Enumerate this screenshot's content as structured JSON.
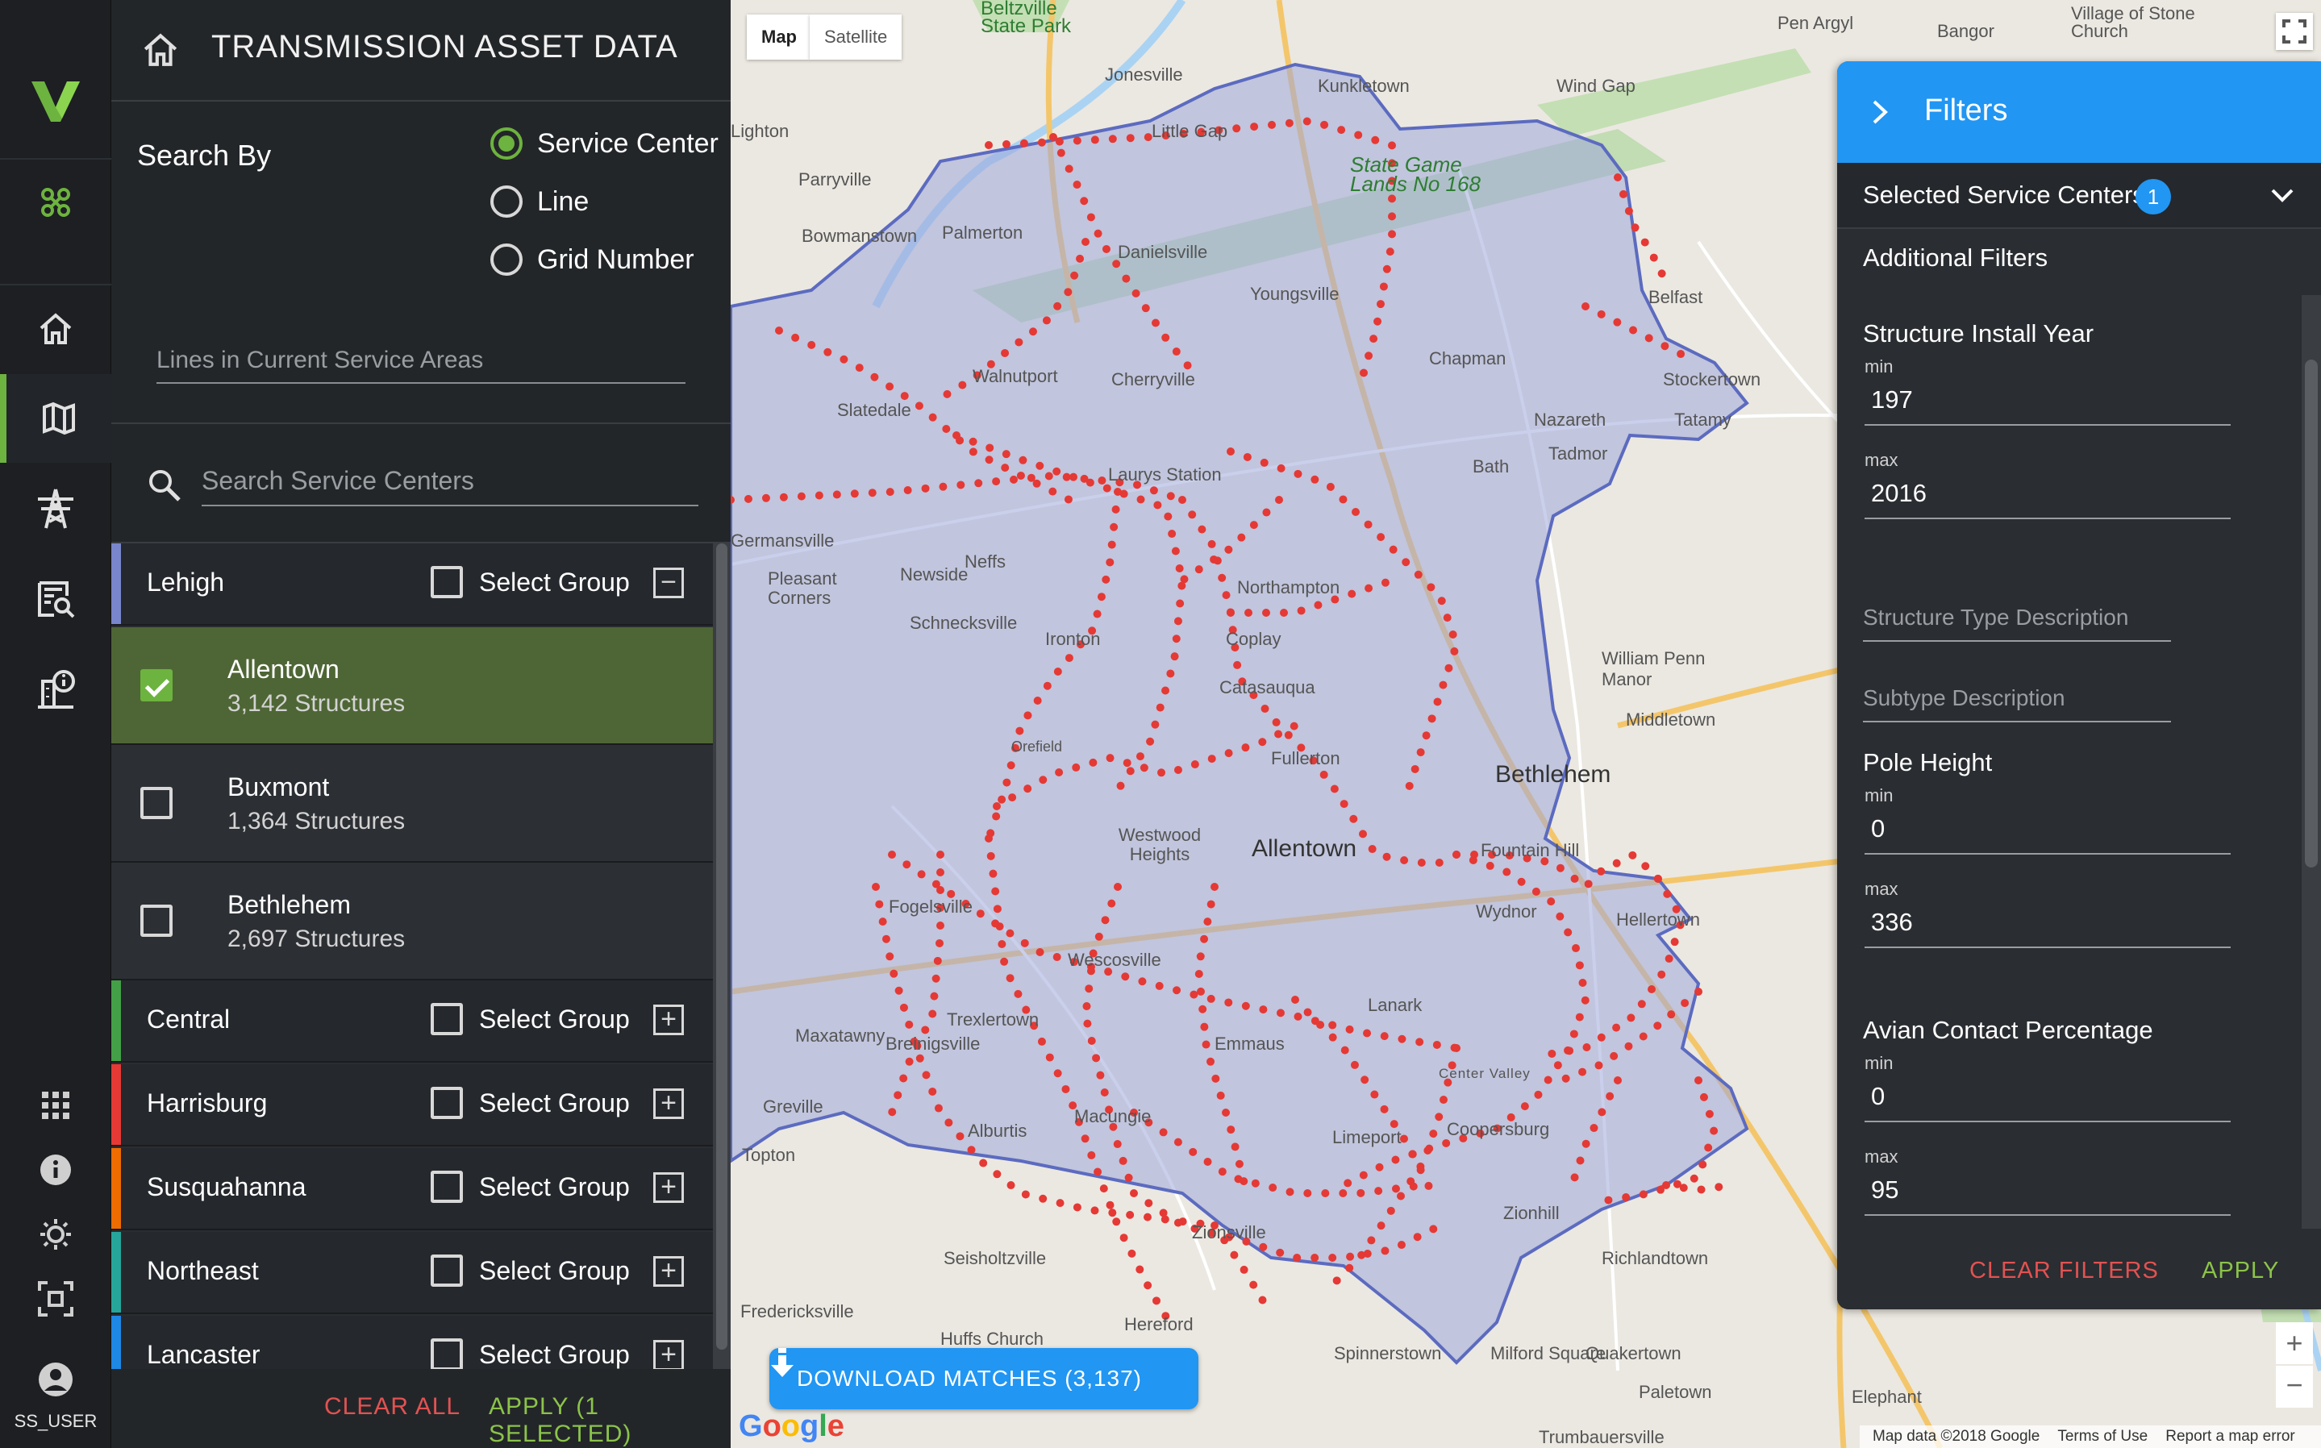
{
  "colors": {
    "accent_green": "#6db33f",
    "accent_blue": "#2196f3",
    "danger_red": "#e25252",
    "map_points": "#e53935",
    "service_area_fill": "#9fa8da"
  },
  "rail": {
    "logo_icon": "brand-v-logo",
    "items": [
      {
        "icon": "network-icon"
      },
      {
        "icon": "home-icon"
      },
      {
        "icon": "map-icon"
      },
      {
        "icon": "transmission-tower-icon"
      },
      {
        "icon": "report-search-icon"
      },
      {
        "icon": "building-info-icon"
      }
    ],
    "bottom_items": [
      {
        "icon": "apps-grid-icon"
      },
      {
        "icon": "info-icon"
      },
      {
        "icon": "settings-gear-icon"
      },
      {
        "icon": "focus-frame-icon"
      },
      {
        "icon": "user-avatar-icon"
      }
    ],
    "user": "SS_USER"
  },
  "panel": {
    "title": "TRANSMISSION ASSET DATA",
    "search_by_label": "Search By",
    "search_by_options": [
      {
        "label": "Service Center",
        "selected": true
      },
      {
        "label": "Line",
        "selected": false
      },
      {
        "label": "Grid Number",
        "selected": false
      }
    ],
    "lines_placeholder": "Lines in Current Service Areas",
    "search_placeholder": "Search Service Centers",
    "select_group_label": "Select Group",
    "groups": [
      {
        "name": "Lehigh",
        "color": "#7986cb",
        "expanded": true,
        "centers": [
          {
            "name": "Allentown",
            "count": "3,142 Structures",
            "checked": true
          },
          {
            "name": "Buxmont",
            "count": "1,364 Structures",
            "checked": false
          },
          {
            "name": "Bethlehem",
            "count": "2,697 Structures",
            "checked": false
          }
        ]
      },
      {
        "name": "Central",
        "color": "#43a047",
        "expanded": false
      },
      {
        "name": "Harrisburg",
        "color": "#e53935",
        "expanded": false
      },
      {
        "name": "Susquahanna",
        "color": "#ef6c00",
        "expanded": false
      },
      {
        "name": "Northeast",
        "color": "#26a69a",
        "expanded": false
      },
      {
        "name": "Lancaster",
        "color": "#1e88e5",
        "expanded": false
      }
    ],
    "clear_all": "CLEAR ALL",
    "apply": "APPLY (1 SELECTED)"
  },
  "map": {
    "type_buttons": [
      "Map",
      "Satellite"
    ],
    "places": [
      {
        "name": "Beltzville State Park"
      },
      {
        "name": "Pen Argyl"
      },
      {
        "name": "Bangor"
      },
      {
        "name": "Village of Stone Church"
      },
      {
        "name": "Jonesville"
      },
      {
        "name": "Kunkletown"
      },
      {
        "name": "Wind Gap"
      },
      {
        "name": "Little Gap"
      },
      {
        "name": "State Game Lands No 168"
      },
      {
        "name": "Lighton"
      },
      {
        "name": "Parryville"
      },
      {
        "name": "Bowmanstown"
      },
      {
        "name": "Palmerton"
      },
      {
        "name": "Danielsville"
      },
      {
        "name": "Youngsville"
      },
      {
        "name": "Belfast"
      },
      {
        "name": "Walnutport"
      },
      {
        "name": "Cherryville"
      },
      {
        "name": "Chapman"
      },
      {
        "name": "Stockertown"
      },
      {
        "name": "Slatedale"
      },
      {
        "name": "Nazareth"
      },
      {
        "name": "Tatamy"
      },
      {
        "name": "Laurys Station"
      },
      {
        "name": "Bath"
      },
      {
        "name": "Tadmor"
      },
      {
        "name": "Germansville"
      },
      {
        "name": "Newside"
      },
      {
        "name": "Neffs"
      },
      {
        "name": "Pleasant Corners"
      },
      {
        "name": "Northampton"
      },
      {
        "name": "Schnecksville"
      },
      {
        "name": "Ironton"
      },
      {
        "name": "Coplay"
      },
      {
        "name": "Catasauqua"
      },
      {
        "name": "William Penn Manor"
      },
      {
        "name": "Middletown"
      },
      {
        "name": "Orefield"
      },
      {
        "name": "Fullerton"
      },
      {
        "name": "Bethlehem"
      },
      {
        "name": "Westwood Heights"
      },
      {
        "name": "Allentown"
      },
      {
        "name": "Fountain Hill"
      },
      {
        "name": "Fogelsville"
      },
      {
        "name": "Wydnor"
      },
      {
        "name": "Hellertown"
      },
      {
        "name": "Wescosville"
      },
      {
        "name": "Trexlertown"
      },
      {
        "name": "Maxatawny"
      },
      {
        "name": "Breinigsville"
      },
      {
        "name": "Lanark"
      },
      {
        "name": "Emmaus"
      },
      {
        "name": "Center Valley"
      },
      {
        "name": "Greville"
      },
      {
        "name": "Alburtis"
      },
      {
        "name": "Macungie"
      },
      {
        "name": "Limeport"
      },
      {
        "name": "Coopersburg"
      },
      {
        "name": "Topton"
      },
      {
        "name": "Zionsville"
      },
      {
        "name": "Zionhill"
      },
      {
        "name": "Seisholtzville"
      },
      {
        "name": "Richlandtown"
      },
      {
        "name": "Fredericksville"
      },
      {
        "name": "Huffs Church"
      },
      {
        "name": "Hereford"
      },
      {
        "name": "Spinnerstown"
      },
      {
        "name": "Milford Square"
      },
      {
        "name": "Quakertown"
      },
      {
        "name": "Elephant"
      },
      {
        "name": "Paletown"
      },
      {
        "name": "Trumbauersville"
      }
    ],
    "download_label": "DOWNLOAD MATCHES (3,137)",
    "google_logo": "Google",
    "footer": [
      "Map data ©2018 Google",
      "Terms of Use",
      "Report a map error"
    ],
    "zoom_in": "+",
    "zoom_out": "−"
  },
  "filters": {
    "title": "Filters",
    "selected_centers_label": "Selected Service Centers",
    "selected_count": "1",
    "additional_label": "Additional Filters",
    "structure_install_year": {
      "label": "Structure Install Year",
      "min_label": "min",
      "min": "197",
      "max_label": "max",
      "max": "2016"
    },
    "structure_type_placeholder": "Structure Type Description",
    "subtype_placeholder": "Subtype Description",
    "pole_height": {
      "label": "Pole Height",
      "min_label": "min",
      "min": "0",
      "max_label": "max",
      "max": "336"
    },
    "avian_contact": {
      "label": "Avian Contact Percentage",
      "min_label": "min",
      "min": "0",
      "max_label": "max",
      "max": "95"
    },
    "clear": "CLEAR FILTERS",
    "apply": "APPLY"
  }
}
